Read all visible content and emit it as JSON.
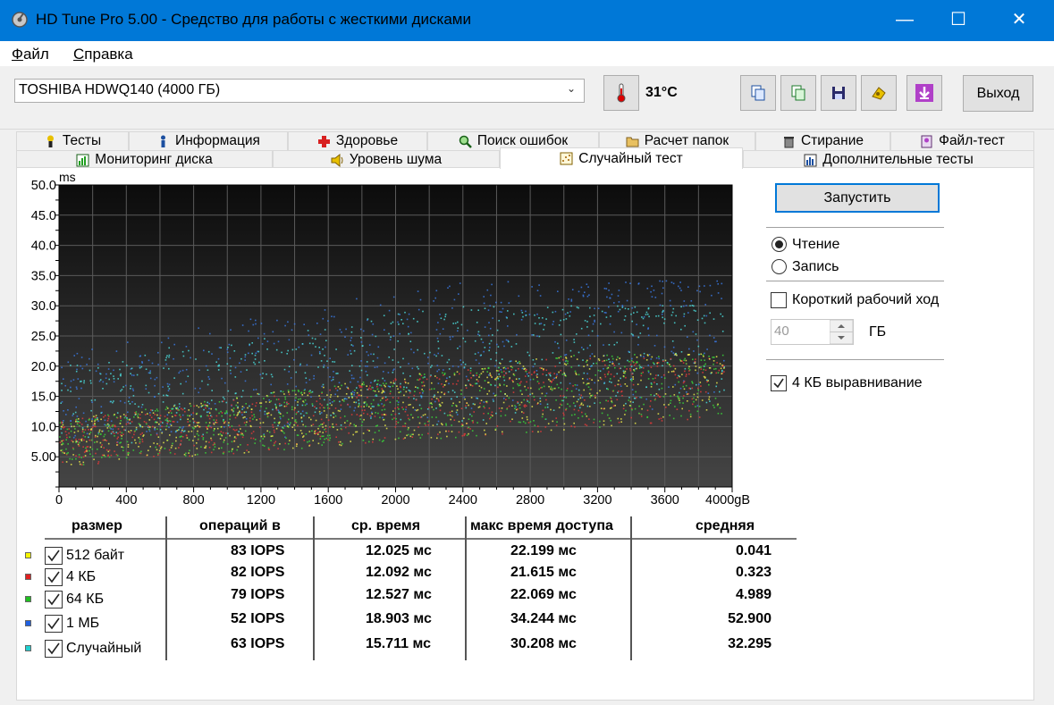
{
  "window": {
    "title": "HD Tune Pro 5.00 - Средство для работы с жесткими дисками",
    "controls": {
      "minimize": "—",
      "maximize": "☐",
      "close": "✕"
    }
  },
  "menu": [
    "Файл",
    "Справка"
  ],
  "toolbar": {
    "drive": "TOSHIBA HDWQ140 (4000 ГБ)",
    "temperature": "31°C",
    "exit_label": "Выход",
    "buttons": [
      "copy-icon",
      "copy-all-icon",
      "save-icon",
      "options-icon",
      "download-icon"
    ]
  },
  "tabs_row1": [
    {
      "label": "Тесты",
      "icon": "benchmark-icon"
    },
    {
      "label": "Информация",
      "icon": "info-icon"
    },
    {
      "label": "Здоровье",
      "icon": "health-icon"
    },
    {
      "label": "Поиск ошибок",
      "icon": "error-scan-icon"
    },
    {
      "label": "Расчет папок",
      "icon": "folder-usage-icon"
    },
    {
      "label": "Стирание",
      "icon": "erase-icon"
    },
    {
      "label": "Файл-тест",
      "icon": "file-benchmark-icon"
    }
  ],
  "tabs_row2": [
    {
      "label": "Мониторинг диска",
      "icon": "disk-monitor-icon",
      "active": false
    },
    {
      "label": "Уровень шума",
      "icon": "aam-icon",
      "active": false
    },
    {
      "label": "Случайный тест",
      "icon": "random-access-icon",
      "active": true
    },
    {
      "label": "Дополнительные тесты",
      "icon": "extra-tests-icon",
      "active": false
    }
  ],
  "chart_data": {
    "type": "scatter",
    "ylabel": "ms",
    "xlabel": "",
    "y_ticks": [
      "50.0",
      "45.0",
      "40.0",
      "35.0",
      "30.0",
      "25.0",
      "20.0",
      "15.0",
      "10.0",
      "5.00"
    ],
    "x_ticks": [
      "0",
      "400",
      "800",
      "1200",
      "1600",
      "2000",
      "2400",
      "2800",
      "3200",
      "3600",
      "4000gB"
    ],
    "xlim": [
      0,
      4000
    ],
    "ylim": [
      0,
      50
    ],
    "grid": true,
    "background": "#1a1a1a",
    "series_colors": {
      "512b": "#e8e84a",
      "4kb": "#e03a3a",
      "64kb": "#3ad23a",
      "1mb": "#3a78e0",
      "random": "#4ad8d8"
    },
    "series": [
      {
        "key": "512b",
        "avg_ms": 12.025,
        "max_ms": 22.199
      },
      {
        "key": "4kb",
        "avg_ms": 12.092,
        "max_ms": 21.615
      },
      {
        "key": "64kb",
        "avg_ms": 12.527,
        "max_ms": 22.069
      },
      {
        "key": "1mb",
        "avg_ms": 18.903,
        "max_ms": 34.244
      },
      {
        "key": "random",
        "avg_ms": 15.711,
        "max_ms": 30.208
      }
    ]
  },
  "controls": {
    "run_label": "Запустить",
    "read_label": "Чтение",
    "write_label": "Запись",
    "short_stroke_label": "Короткий рабочий ход",
    "short_stroke_value": "40",
    "short_stroke_unit": "ГБ",
    "align_label": "4 КБ выравнивание"
  },
  "table": {
    "headers": [
      "размер",
      "операций в",
      "ср. время",
      "макс время доступа",
      "средняя"
    ],
    "rows": [
      {
        "size": "512 байт",
        "color": "#f5f500",
        "iops": "83 IOPS",
        "avg": "12.025 мс",
        "max": "22.199 мс",
        "mean": "0.041"
      },
      {
        "size": "4 КБ",
        "color": "#e02020",
        "iops": "82 IOPS",
        "avg": "12.092 мс",
        "max": "21.615 мс",
        "mean": "0.323"
      },
      {
        "size": "64 КБ",
        "color": "#20c020",
        "iops": "79 IOPS",
        "avg": "12.527 мс",
        "max": "22.069 мс",
        "mean": "4.989"
      },
      {
        "size": "1 МБ",
        "color": "#2060e0",
        "iops": "52 IOPS",
        "avg": "18.903 мс",
        "max": "34.244 мс",
        "mean": "52.900"
      },
      {
        "size": "Случайный",
        "color": "#20d0d0",
        "iops": "63 IOPS",
        "avg": "15.711 мс",
        "max": "30.208 мс",
        "mean": "32.295"
      }
    ]
  }
}
